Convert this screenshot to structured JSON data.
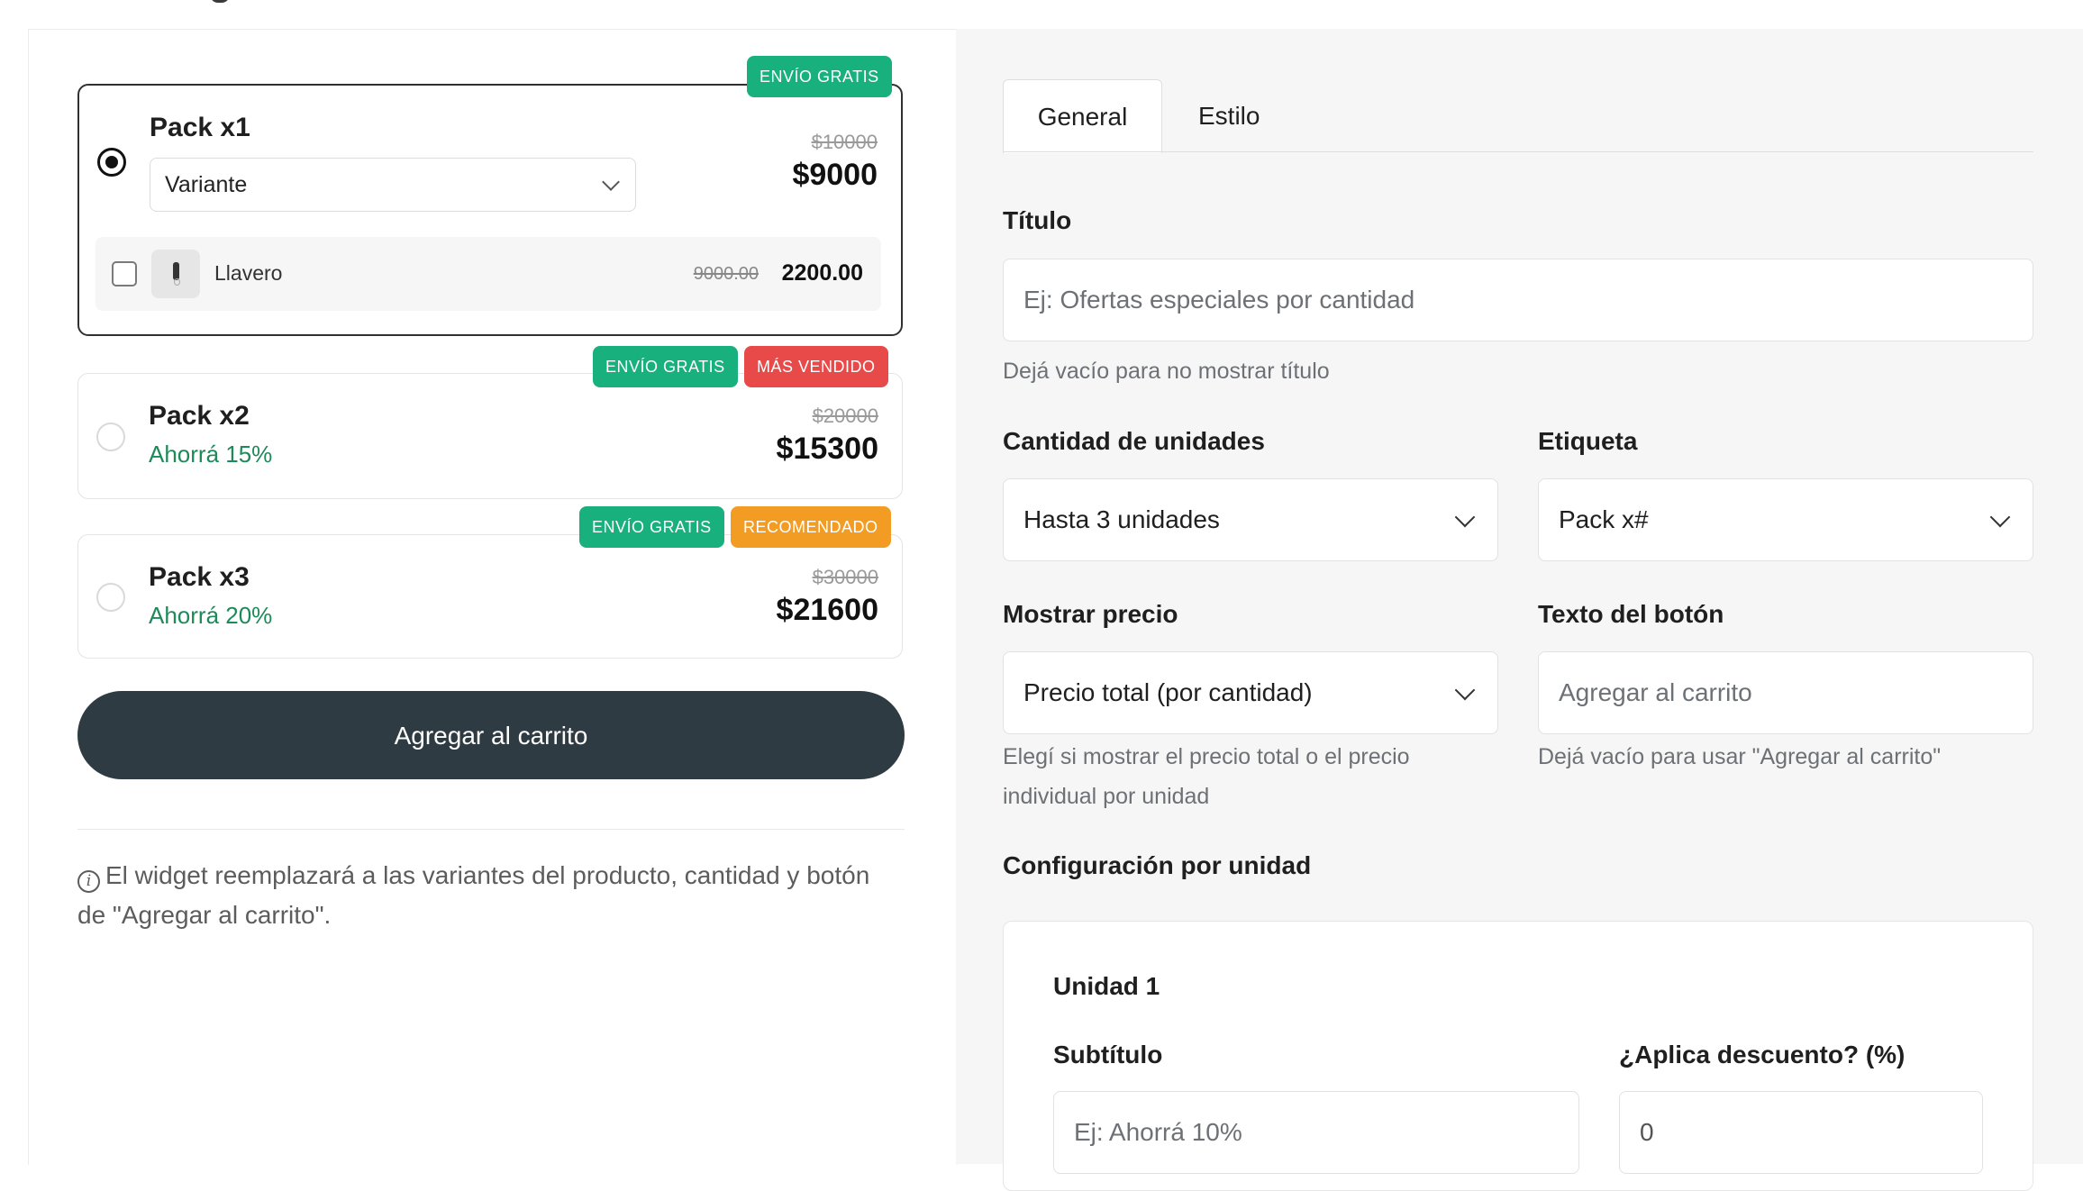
{
  "packs": [
    {
      "title": "Pack x1",
      "variant_value": "Variante",
      "price_old": "$10000",
      "price_new": "$9000",
      "badges": [
        "ENVÍO GRATIS"
      ],
      "addon": {
        "name": "Llavero",
        "price_old": "9000.00",
        "price_new": "2200.00"
      }
    },
    {
      "title": "Pack x2",
      "subtitle": "Ahorrá 15%",
      "price_old": "$20000",
      "price_new": "$15300",
      "badges": [
        "ENVÍO GRATIS",
        "MÁS VENDIDO"
      ]
    },
    {
      "title": "Pack x3",
      "subtitle": "Ahorrá 20%",
      "price_old": "$30000",
      "price_new": "$21600",
      "badges": [
        "ENVÍO GRATIS",
        "RECOMENDADO"
      ]
    }
  ],
  "cart_button": "Agregar al carrito",
  "info_text": "El widget reemplazará a las variantes del producto, cantidad y botón de \"Agregar al carrito\".",
  "colors": {
    "badge_green": "#18b07d",
    "badge_red": "#e84a4a",
    "badge_orange": "#f39c24",
    "savings_green": "#1e8a5a",
    "cart_button_bg": "#2e3b43"
  },
  "tabs": [
    "General",
    "Estilo"
  ],
  "settings": {
    "title_label": "Título",
    "title_placeholder": "Ej: Ofertas especiales por cantidad",
    "title_help": "Dejá vacío para no mostrar título",
    "quantity_label": "Cantidad de unidades",
    "quantity_value": "Hasta 3 unidades",
    "tag_label": "Etiqueta",
    "tag_value": "Pack x#",
    "show_price_label": "Mostrar precio",
    "show_price_value": "Precio total (por cantidad)",
    "show_price_help": "Elegí si mostrar el precio total o el precio individual por unidad",
    "button_text_label": "Texto del botón",
    "button_text_placeholder": "Agregar al carrito",
    "button_text_help": "Dejá vacío para usar \"Agregar al carrito\"",
    "per_unit_label": "Configuración por unidad"
  },
  "unit": {
    "heading": "Unidad 1",
    "subtitle_label": "Subtítulo",
    "subtitle_placeholder": "Ej: Ahorrá 10%",
    "discount_label": "¿Aplica descuento? (%)",
    "discount_value": "0"
  }
}
